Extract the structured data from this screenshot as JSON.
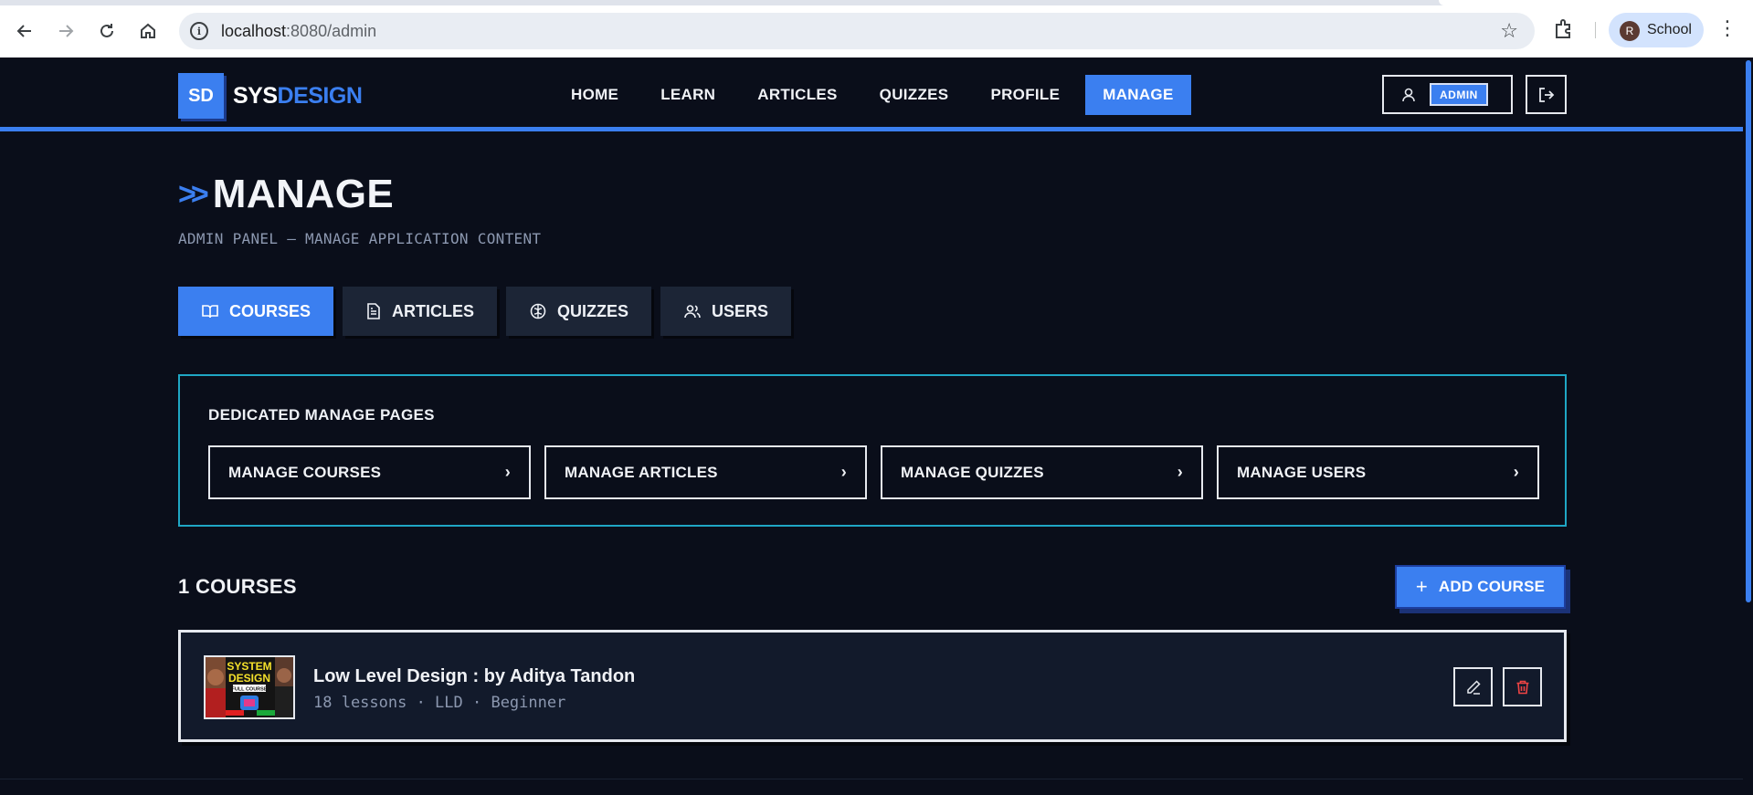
{
  "browser": {
    "url_host": "localhost",
    "url_path": ":8080/admin",
    "profile_initial": "R",
    "profile_name": "School"
  },
  "header": {
    "logo_badge": "SD",
    "logo_sys": "SYS",
    "logo_design": "DESIGN",
    "nav": [
      "HOME",
      "LEARN",
      "ARTICLES",
      "QUIZZES",
      "PROFILE",
      "MANAGE"
    ],
    "active_nav": "MANAGE",
    "role_badge": "ADMIN"
  },
  "page": {
    "title": "MANAGE",
    "subtitle": "ADMIN PANEL — MANAGE APPLICATION CONTENT"
  },
  "tabs": [
    {
      "label": "COURSES",
      "icon": "book-open-icon",
      "active": true
    },
    {
      "label": "ARTICLES",
      "icon": "file-text-icon",
      "active": false
    },
    {
      "label": "QUIZZES",
      "icon": "brain-icon",
      "active": false
    },
    {
      "label": "USERS",
      "icon": "users-icon",
      "active": false
    }
  ],
  "dedicated": {
    "title": "DEDICATED MANAGE PAGES",
    "links": [
      "MANAGE COURSES",
      "MANAGE ARTICLES",
      "MANAGE QUIZZES",
      "MANAGE USERS"
    ]
  },
  "courses": {
    "count_label": "1 COURSES",
    "add_label": "ADD COURSE",
    "items": [
      {
        "title": "Low Level Design : by Aditya Tandon",
        "meta": "18 lessons · LLD · Beginner",
        "thumb_line1": "SYSTEM",
        "thumb_line2": "DESIGN",
        "thumb_line3": "FULL COURSE"
      }
    ]
  },
  "colors": {
    "accent": "#3b7ff0",
    "background": "#0a0e1a",
    "panel_border": "#1fa6c4",
    "danger": "#ef4444"
  }
}
